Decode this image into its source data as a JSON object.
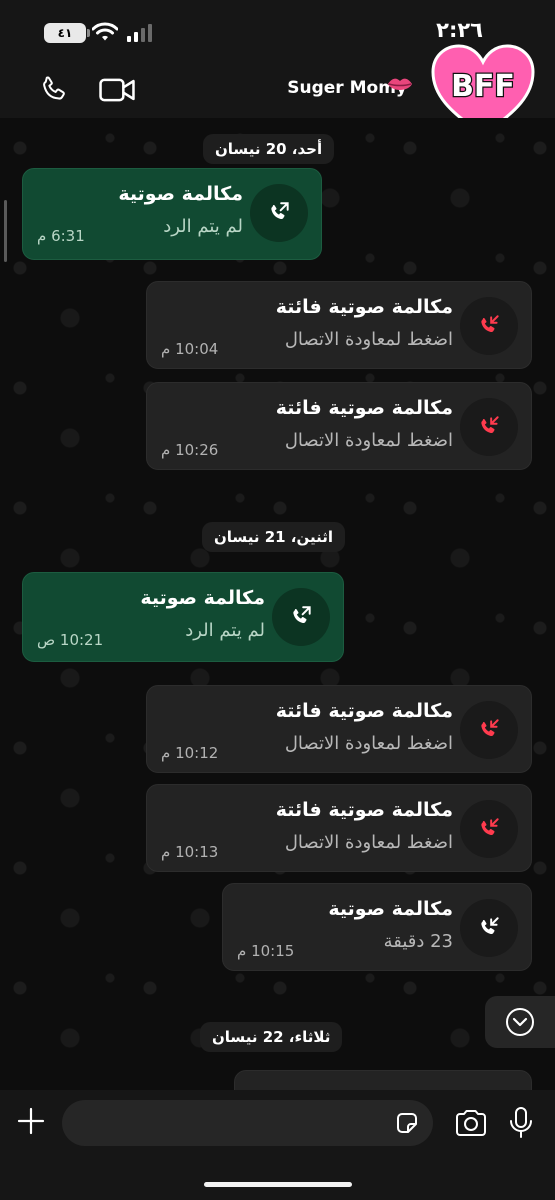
{
  "status_bar": {
    "time": "٢:٢٦",
    "battery": "٤١"
  },
  "header": {
    "contact_name": "Suger Momy",
    "avatar_text": "BFF"
  },
  "chat": {
    "dates": [
      "أحد، 20 نيسان",
      "اثنين، 21 نيسان",
      "ثلاثاء، 22 نيسان"
    ],
    "messages": [
      {
        "title": "مكالمة صوتية",
        "subtitle": "لم يتم الرد",
        "time": "6:31 م"
      },
      {
        "title": "مكالمة صوتية فائتة",
        "subtitle": "اضغط لمعاودة الاتصال",
        "time": "10:04 م"
      },
      {
        "title": "مكالمة صوتية فائتة",
        "subtitle": "اضغط لمعاودة الاتصال",
        "time": "10:26 م"
      },
      {
        "title": "مكالمة صوتية",
        "subtitle": "لم يتم الرد",
        "time": "10:21 ص"
      },
      {
        "title": "مكالمة صوتية فائتة",
        "subtitle": "اضغط لمعاودة الاتصال",
        "time": "10:12 م"
      },
      {
        "title": "مكالمة صوتية فائتة",
        "subtitle": "اضغط لمعاودة الاتصال",
        "time": "10:13 م"
      },
      {
        "title": "مكالمة صوتية",
        "subtitle": "23 دقيقة",
        "time": "10:15 م"
      }
    ]
  },
  "input": {
    "placeholder": ""
  },
  "colors": {
    "outgoing_bubble": "#114a32",
    "incoming_bubble": "#232323",
    "missed_call": "#ff3b4e",
    "avatar_heart": "#ff5fb0"
  },
  "icons": [
    "phone-icon",
    "video-icon",
    "lips-emoji-icon",
    "outgoing-call-icon",
    "missed-call-icon",
    "incoming-call-icon",
    "chevron-down-icon",
    "plus-icon",
    "sticker-icon",
    "camera-icon",
    "microphone-icon"
  ]
}
